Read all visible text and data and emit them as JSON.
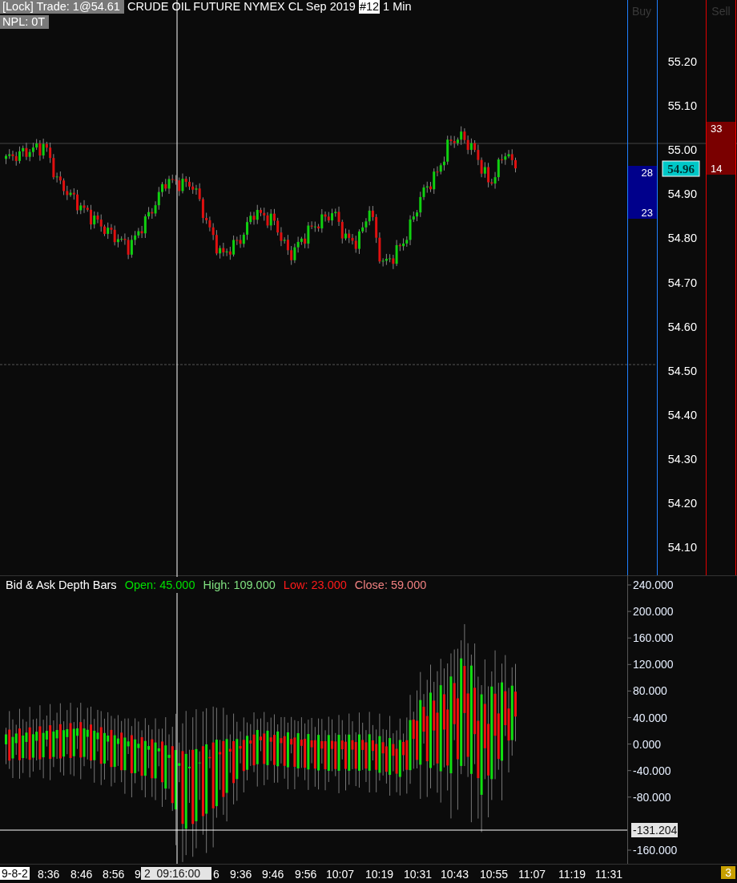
{
  "header": {
    "lock_label": "[Lock] Trade: 1@54.61",
    "instrument": "CRUDE OIL FUTURE NYMEX CL Sep 2019",
    "chart_number": "#12",
    "interval": "1 Min",
    "npl": "NPL: 0T"
  },
  "price_pane": {
    "buy_heading": "Buy",
    "sell_heading": "Sell",
    "price_labels": [
      "55.20",
      "55.10",
      "55.00",
      "54.90",
      "54.80",
      "54.70",
      "54.60",
      "54.50",
      "54.40",
      "54.30",
      "54.20",
      "54.10"
    ],
    "current_price": "54.96",
    "buy_depth": [
      "28",
      "23"
    ],
    "sell_depth": [
      "33",
      "14"
    ]
  },
  "depth_pane": {
    "title": "Bid & Ask Depth Bars",
    "stats": [
      {
        "label": "Open: 45.000",
        "color": "#00e000"
      },
      {
        "label": "High: 109.000",
        "color": "#80e080"
      },
      {
        "label": "Low: 23.000",
        "color": "#ff1a1a"
      },
      {
        "label": "Close: 59.000",
        "color": "#f08080"
      }
    ],
    "axis_labels": [
      "240.000",
      "200.000",
      "160.000",
      "120.000",
      "80.000",
      "40.000",
      "0.000",
      "-40.000",
      "-80.000",
      "-160.000"
    ],
    "crosshair_value": "-131.204"
  },
  "time_axis": {
    "date_label": "9-8-2",
    "labels": [
      "8:36",
      "8:46",
      "8:56",
      "9",
      "6",
      "9:36",
      "9:46",
      "9:56",
      "10:07",
      "10:19",
      "10:31",
      "10:43",
      "10:55",
      "11:07",
      "11:19",
      "11:31"
    ],
    "crosshair_time": "2  09:16:00",
    "corner_badge": "3"
  }
}
